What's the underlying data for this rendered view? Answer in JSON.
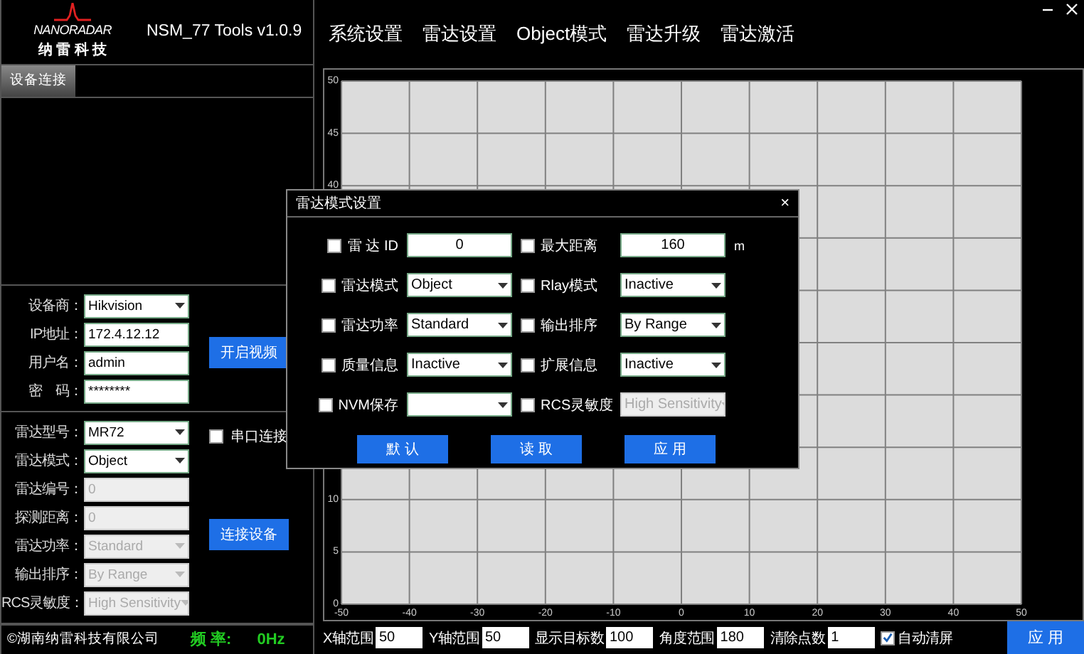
{
  "header": {
    "logo_text": "NANORADAR",
    "logo_subtext": "纳 雷 科 技",
    "title": "NSM_77 Tools v1.0.9"
  },
  "nav": [
    {
      "label": "系统设置"
    },
    {
      "label": "雷达设置"
    },
    {
      "label": "Object模式"
    },
    {
      "label": "雷达升级"
    },
    {
      "label": "雷达激活"
    }
  ],
  "sidebar": {
    "tabs": [
      {
        "label": "设备连接",
        "selected": true
      }
    ],
    "video_form": {
      "fields": [
        {
          "label": "设备商：",
          "kind": "select",
          "value": "Hikvision",
          "disabled": false
        },
        {
          "label": "IP地址：",
          "kind": "input",
          "value": "172.4.12.12",
          "disabled": false
        },
        {
          "label": "用户名：",
          "kind": "input",
          "value": "admin",
          "disabled": false
        },
        {
          "label": "密　码：",
          "kind": "input",
          "value": "********",
          "disabled": false
        }
      ],
      "button": "开启视频"
    },
    "device_form": {
      "fields": [
        {
          "label": "雷达型号：",
          "kind": "select",
          "value": "MR72",
          "disabled": false
        },
        {
          "label": "雷达模式：",
          "kind": "select",
          "value": "Object",
          "disabled": false
        },
        {
          "label": "雷达编号：",
          "kind": "input",
          "value": "0",
          "disabled": true
        },
        {
          "label": "探测距离：",
          "kind": "input",
          "value": "0",
          "disabled": true
        },
        {
          "label": "雷达功率：",
          "kind": "select",
          "value": "Standard",
          "disabled": true
        },
        {
          "label": "输出排序：",
          "kind": "select",
          "value": "By Range",
          "disabled": true
        },
        {
          "label": "RCS灵敏度：",
          "kind": "select",
          "value": "High Sensitivity",
          "disabled": true
        }
      ],
      "serial": {
        "label": "串口连接",
        "checked": false
      },
      "button": "连接设备"
    },
    "footer": {
      "copyright": "©湖南纳雷科技有限公司",
      "frequency_label": "频 率:",
      "frequency_value": "0Hz"
    }
  },
  "chart": {
    "chart_data": {
      "type": "scatter",
      "grid": true,
      "xlim": [
        -50,
        50
      ],
      "ylim": [
        0,
        50
      ],
      "xticks": [
        -50,
        -40,
        -30,
        -20,
        -10,
        0,
        10,
        20,
        30,
        40,
        50
      ],
      "yticks": [
        0,
        5,
        10,
        40,
        45,
        50
      ]
    }
  },
  "bottom_bar": {
    "fields": [
      {
        "label": "X轴范围",
        "value": "50"
      },
      {
        "label": "Y轴范围",
        "value": "50"
      },
      {
        "label": "显示目标数",
        "value": "100"
      },
      {
        "label": "角度范围",
        "value": "180"
      },
      {
        "label": "清除点数",
        "value": "1"
      }
    ],
    "auto_clear": {
      "label": "自动清屏",
      "checked": true
    },
    "button": "应 用"
  },
  "dialog": {
    "title": "雷达模式设置",
    "close": "×",
    "rows": [
      [
        {
          "label": "雷 达 ID",
          "kind": "input",
          "value": "0",
          "checked": false,
          "disabled": false
        },
        {
          "label": "最大距离",
          "kind": "input",
          "value": "160",
          "unit": "m",
          "checked": false,
          "disabled": false
        }
      ],
      [
        {
          "label": "雷达模式",
          "kind": "select",
          "value": "Object",
          "checked": false,
          "disabled": false
        },
        {
          "label": "Rlay模式",
          "kind": "select",
          "value": "Inactive",
          "checked": false,
          "disabled": false
        }
      ],
      [
        {
          "label": "雷达功率",
          "kind": "select",
          "value": "Standard",
          "checked": false,
          "disabled": false
        },
        {
          "label": "输出排序",
          "kind": "select",
          "value": "By Range",
          "checked": false,
          "disabled": false
        }
      ],
      [
        {
          "label": "质量信息",
          "kind": "select",
          "value": "Inactive",
          "checked": false,
          "disabled": false
        },
        {
          "label": "扩展信息",
          "kind": "select",
          "value": "Inactive",
          "checked": false,
          "disabled": false
        }
      ],
      [
        {
          "label": "NVM保存",
          "kind": "select",
          "checked": false,
          "disabled": false
        },
        {
          "label": "RCS灵敏度",
          "kind": "select",
          "value": "High Sensitivity",
          "checked": false,
          "disabled": true
        }
      ]
    ],
    "buttons": [
      "默 认",
      "读 取",
      "应 用"
    ]
  }
}
